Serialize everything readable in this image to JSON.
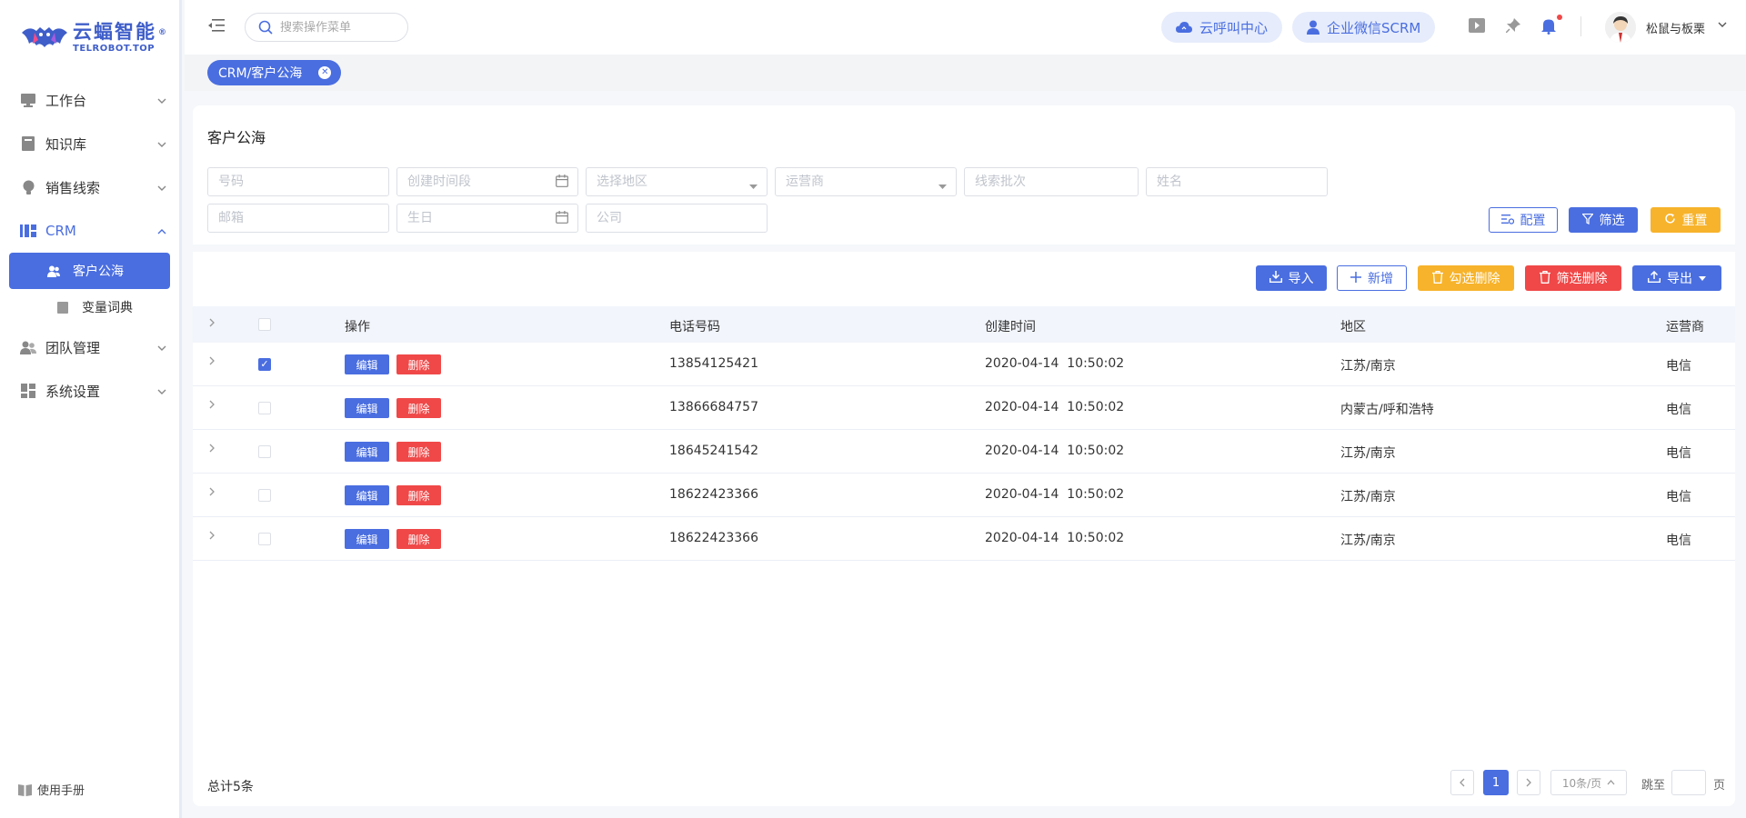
{
  "brand": {
    "name_cn": "云蝠智能",
    "name_en": "TELROBOT.TOP",
    "reg": "®"
  },
  "sidebar": {
    "items": [
      {
        "label": "工作台",
        "icon": "monitor-icon"
      },
      {
        "label": "知识库",
        "icon": "book-icon"
      },
      {
        "label": "销售线索",
        "icon": "bulb-icon"
      },
      {
        "label": "CRM",
        "icon": "crm-icon"
      },
      {
        "label": "团队管理",
        "icon": "team-icon"
      },
      {
        "label": "系统设置",
        "icon": "grid-icon"
      }
    ],
    "crm_children": [
      {
        "label": "客户公海",
        "icon": "users-icon"
      },
      {
        "label": "变量词典",
        "icon": "book-icon"
      }
    ],
    "manual": "使用手册"
  },
  "header": {
    "search_placeholder": "搜索操作菜单",
    "pill_call": "云呼叫中心",
    "pill_scrm": "企业微信SCRM",
    "user": "松鼠与板栗"
  },
  "tagbar": {
    "tag": "CRM/客户公海"
  },
  "filter": {
    "title": "客户公海",
    "placeholders": {
      "number": "号码",
      "created_range": "创建时间段",
      "region": "选择地区",
      "carrier": "运营商",
      "batch": "线索批次",
      "name": "姓名",
      "email": "邮箱",
      "birthday": "生日",
      "company": "公司"
    },
    "buttons": {
      "config": "配置",
      "filter": "筛选",
      "reset": "重置"
    }
  },
  "toolbar": {
    "import": "导入",
    "add": "新增",
    "delete_checked": "勾选删除",
    "delete_filtered": "筛选删除",
    "export": "导出"
  },
  "table": {
    "columns": [
      "操作",
      "电话号码",
      "创建时间",
      "地区",
      "运营商"
    ],
    "edit_label": "编辑",
    "delete_label": "删除",
    "rows": [
      {
        "phone": "13854125421",
        "created": "2020-04-14  10:50:02",
        "region": "江苏/南京",
        "carrier": "电信",
        "checked": true
      },
      {
        "phone": "13866684757",
        "created": "2020-04-14  10:50:02",
        "region": "内蒙古/呼和浩特",
        "carrier": "电信",
        "checked": false
      },
      {
        "phone": "18645241542",
        "created": "2020-04-14  10:50:02",
        "region": "江苏/南京",
        "carrier": "电信",
        "checked": false
      },
      {
        "phone": "18622423366",
        "created": "2020-04-14  10:50:02",
        "region": "江苏/南京",
        "carrier": "电信",
        "checked": false
      },
      {
        "phone": "18622423366",
        "created": "2020-04-14  10:50:02",
        "region": "江苏/南京",
        "carrier": "电信",
        "checked": false
      }
    ]
  },
  "pagination": {
    "total": "总计5条",
    "current_page": "1",
    "page_size": "10条/页",
    "jump_label": "跳至",
    "page_suffix": "页"
  },
  "colors": {
    "primary": "#4a6ee0",
    "warning": "#f7b32b",
    "danger": "#f04848"
  }
}
